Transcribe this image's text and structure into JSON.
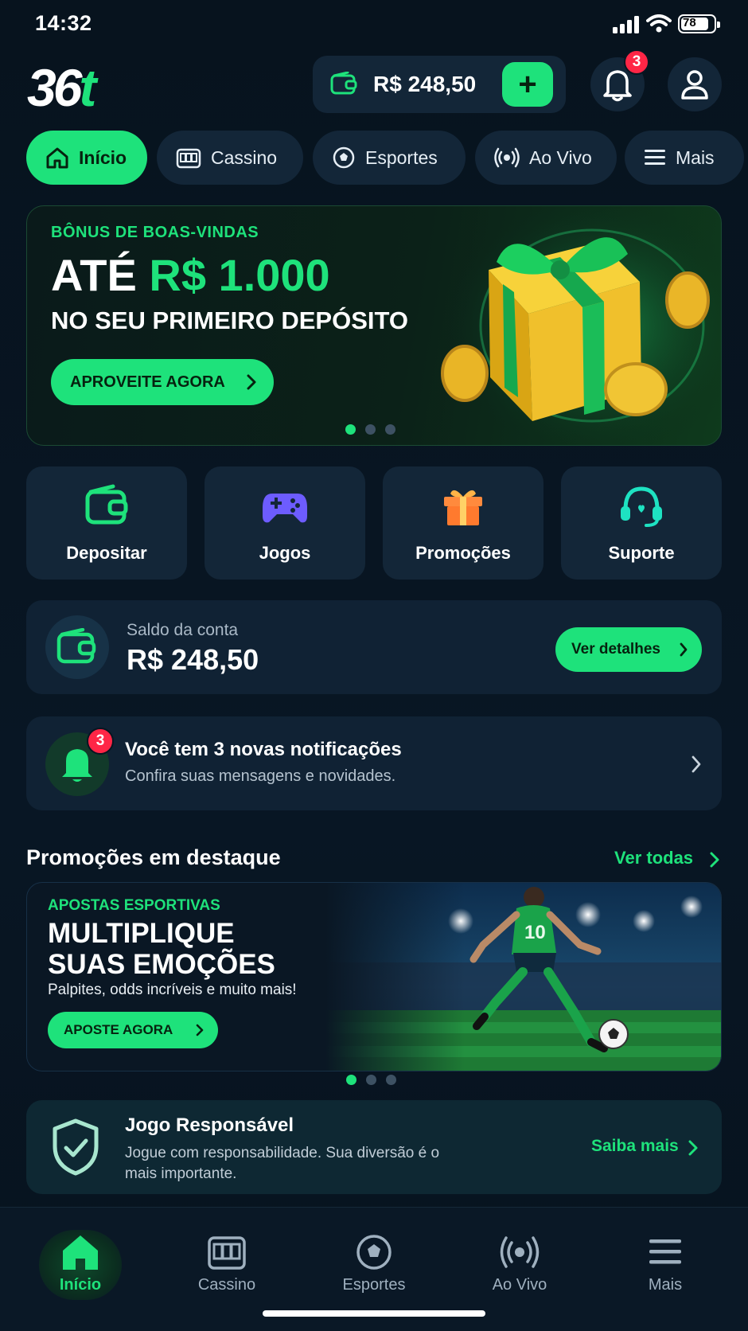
{
  "status_bar": {
    "time": "14:32",
    "battery": "78"
  },
  "header": {
    "logo_main": "36",
    "logo_accent": "t",
    "balance": "R$ 248,50",
    "add_label": "+",
    "notification_count": "3"
  },
  "tabs": [
    {
      "label": "Início",
      "icon": "home-icon",
      "active": true
    },
    {
      "label": "Cassino",
      "icon": "slot-machine-icon"
    },
    {
      "label": "Esportes",
      "icon": "soccer-ball-icon"
    },
    {
      "label": "Ao Vivo",
      "icon": "live-broadcast-icon"
    },
    {
      "label": "Mais",
      "icon": "menu-icon"
    }
  ],
  "hero": {
    "kicker": "BÔNUS DE BOAS-VINDAS",
    "headline_prefix": "ATÉ",
    "headline_amount": "R$ 1.000",
    "subline": "NO SEU PRIMEIRO DEPÓSITO",
    "cta": "APROVEITE AGORA",
    "slides": 3,
    "active_slide": 1
  },
  "quick_actions": [
    {
      "label": "Depositar",
      "icon": "wallet-icon"
    },
    {
      "label": "Jogos",
      "icon": "gamepad-icon"
    },
    {
      "label": "Promoções",
      "icon": "gift-icon"
    },
    {
      "label": "Suporte",
      "icon": "headset-icon"
    }
  ],
  "account": {
    "label": "Saldo da conta",
    "value": "R$ 248,50",
    "details_button": "Ver detalhes"
  },
  "notifications": {
    "count": "3",
    "title": "Você tem 3 novas notificações",
    "description": "Confira suas mensagens e novidades."
  },
  "promos_section": {
    "title": "Promoções em destaque",
    "see_all": "Ver todas",
    "card": {
      "kicker": "APOSTAS ESPORTIVAS",
      "headline_line1": "MULTIPLIQUE",
      "headline_line2": "SUAS EMOÇÕES",
      "subline": "Palpites, odds incríveis e muito mais!",
      "cta": "APOSTE AGORA",
      "player_number": "10"
    },
    "slides": 3,
    "active_slide": 1
  },
  "responsible": {
    "title": "Jogo Responsável",
    "description": "Jogue com responsabilidade. Sua diversão é o mais importante.",
    "link": "Saiba mais"
  },
  "bottom_nav": [
    {
      "label": "Início",
      "icon": "home-icon",
      "active": true
    },
    {
      "label": "Cassino",
      "icon": "slot-machine-icon"
    },
    {
      "label": "Esportes",
      "icon": "soccer-ball-icon"
    },
    {
      "label": "Ao Vivo",
      "icon": "live-broadcast-icon"
    },
    {
      "label": "Mais",
      "icon": "menu-icon"
    }
  ],
  "colors": {
    "accent": "#1ee27b",
    "background": "#081521",
    "card": "#132638",
    "badge": "#ff2646"
  }
}
